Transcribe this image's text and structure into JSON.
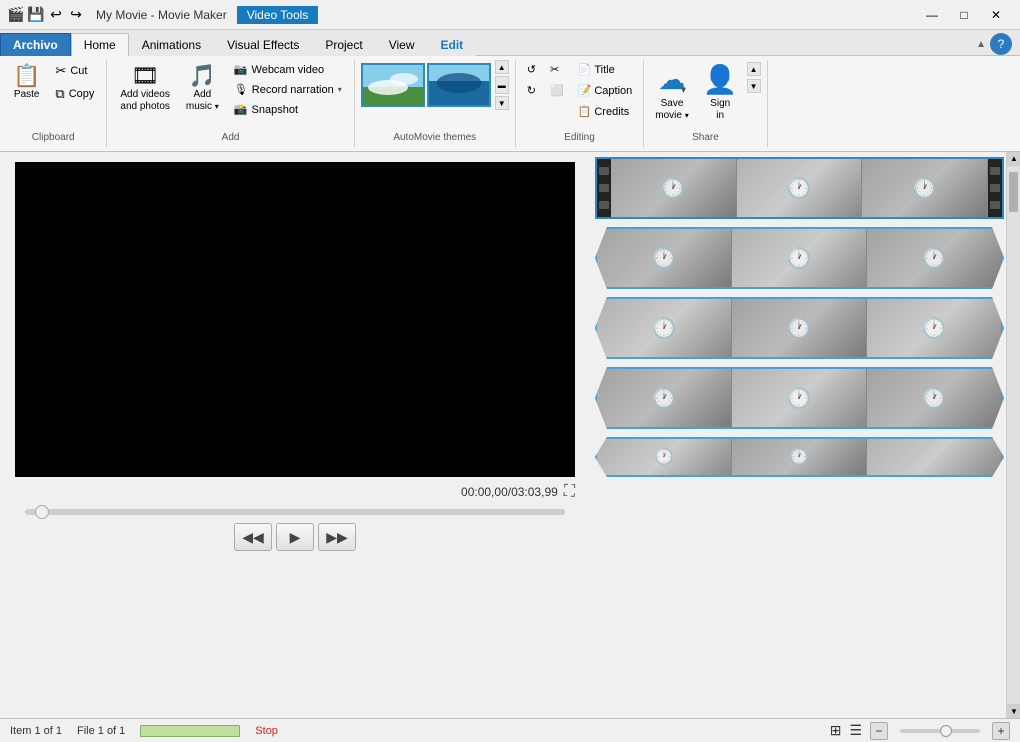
{
  "window": {
    "title": "My Movie - Movie Maker",
    "video_tools_label": "Video Tools"
  },
  "titlebar": {
    "icons": [
      "💾",
      "↩",
      "↪"
    ],
    "min": "—",
    "max": "□",
    "close": "✕"
  },
  "tabs": {
    "archivo": "Archivo",
    "home": "Home",
    "animations": "Animations",
    "visual_effects": "Visual Effects",
    "project": "Project",
    "view": "View",
    "edit": "Edit"
  },
  "ribbon": {
    "clipboard": {
      "label": "Clipboard",
      "paste": "Paste"
    },
    "add": {
      "label": "Add",
      "add_videos": "Add videos\nand photos",
      "add_music": "Add\nmusic",
      "webcam_video": "Webcam video",
      "record_narration": "Record narration",
      "snapshot": "Snapshot"
    },
    "automovie": {
      "label": "AutoMovie themes"
    },
    "editing": {
      "label": "Editing",
      "title": "Title",
      "caption": "Caption",
      "credits": "Credits"
    },
    "share": {
      "label": "Share",
      "save_movie": "Save\nmovie",
      "sign_in": "Sign\nin"
    }
  },
  "preview": {
    "timestamp": "00:00,00/03:03,99",
    "fullscreen_label": "⛶"
  },
  "controls": {
    "prev": "◀◀",
    "play": "▶",
    "next": "▶▶"
  },
  "timeline": {
    "tracks": [
      {
        "frames": 3
      },
      {
        "frames": 3
      },
      {
        "frames": 3
      },
      {
        "frames": 3
      },
      {
        "frames": 3
      }
    ]
  },
  "statusbar": {
    "item": "Item 1 of 1",
    "file": "File 1 of 1",
    "stop": "Stop"
  },
  "help_btn": "?"
}
